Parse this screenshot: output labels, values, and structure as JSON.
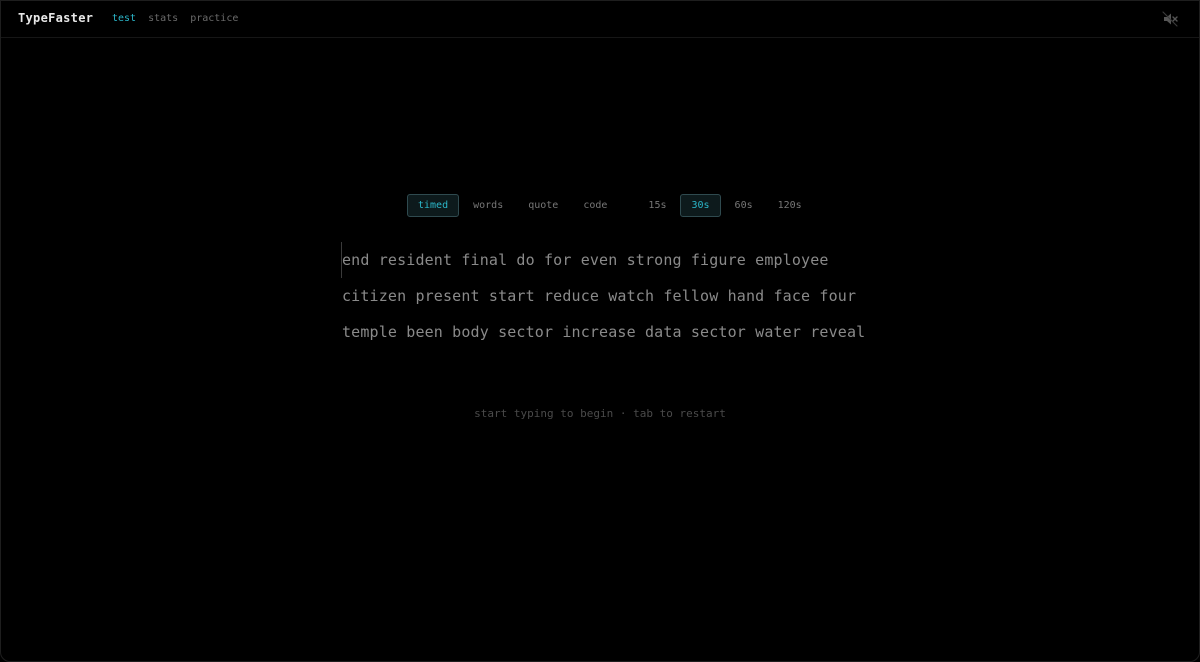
{
  "app": {
    "brand": "TypeFaster"
  },
  "nav": {
    "items": [
      {
        "label": "test",
        "active": true
      },
      {
        "label": "stats",
        "active": false
      },
      {
        "label": "practice",
        "active": false
      }
    ]
  },
  "header": {
    "mute_icon": "speaker-muted-icon"
  },
  "modes": {
    "items": [
      {
        "label": "timed",
        "active": true
      },
      {
        "label": "words",
        "active": false
      },
      {
        "label": "quote",
        "active": false
      },
      {
        "label": "code",
        "active": false
      }
    ]
  },
  "durations": {
    "items": [
      {
        "label": "15s",
        "active": false
      },
      {
        "label": "30s",
        "active": true
      },
      {
        "label": "60s",
        "active": false
      },
      {
        "label": "120s",
        "active": false
      }
    ]
  },
  "words": {
    "lines": [
      "end resident final do for even strong figure employee",
      "citizen present start reduce watch fellow hand face four",
      "temple been body sector increase data sector water reveal"
    ]
  },
  "hint": {
    "text": "start typing to begin · tab to restart"
  },
  "colors": {
    "accent": "#2bb6c9",
    "background": "#000000",
    "text_dim": "#8a8a8a"
  }
}
